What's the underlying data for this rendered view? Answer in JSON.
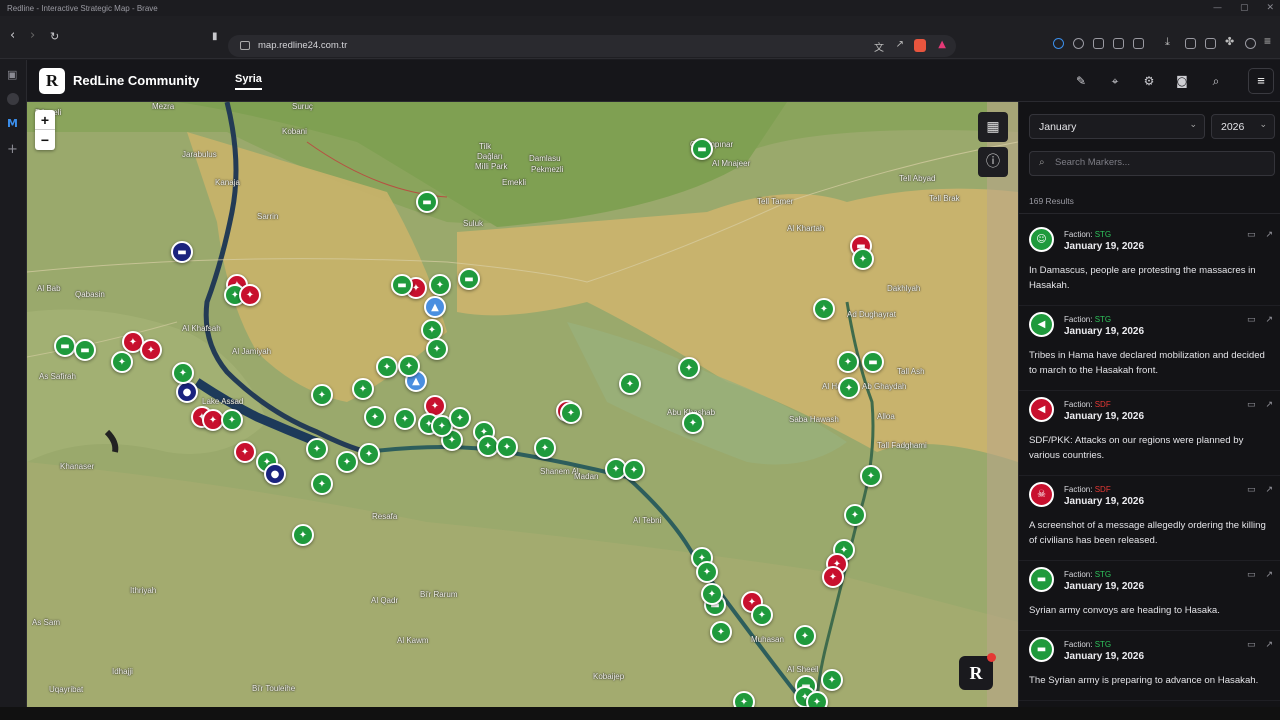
{
  "browser": {
    "title": "Redline - Interactive Strategic Map - Brave",
    "url": "map.redline24.com.tr",
    "icons": [
      "back-icon",
      "forward-icon",
      "reload-icon",
      "bookmark-icon",
      "translate-icon",
      "share-icon",
      "brave-shield-icon",
      "rewards-icon",
      "extensions-icon",
      "download-icon",
      "sidebar-toggle-icon",
      "wallet-icon",
      "menu-icon"
    ]
  },
  "app": {
    "logo": "R",
    "brand": "RedLine Community",
    "tab": "Syria",
    "header_icons": [
      "pen-icon",
      "pin-icon",
      "gear-icon",
      "camera-icon",
      "search-icon"
    ],
    "menu_icon": "hamburger-icon"
  },
  "map": {
    "zoom_in": "+",
    "zoom_out": "−",
    "controls": [
      "map-icon",
      "info-icon"
    ],
    "badge": "R",
    "labels": [
      {
        "text": "Mezra"
      },
      {
        "text": "Suruç"
      },
      {
        "text": "Düzceli"
      },
      {
        "text": "Kobani"
      },
      {
        "text": "Tilk"
      },
      {
        "text": "Dağları"
      },
      {
        "text": "Milli Park"
      },
      {
        "text": "Damlasu"
      },
      {
        "text": "Pekmezli"
      },
      {
        "text": "Emekli"
      },
      {
        "text": "Ceylanpınar"
      },
      {
        "text": "Al Mnajeer"
      },
      {
        "text": "Tell Abyad"
      },
      {
        "text": "Tell Brak"
      },
      {
        "text": "Tell Tamer"
      },
      {
        "text": "Al Khartah"
      },
      {
        "text": "Dakhlyah"
      },
      {
        "text": "Ad Dughayrat"
      },
      {
        "text": "Jarabulus"
      },
      {
        "text": "Kanaja"
      },
      {
        "text": "Sarrin"
      },
      {
        "text": "Suluk"
      },
      {
        "text": "Al Bab"
      },
      {
        "text": "Qabasin"
      },
      {
        "text": "Al Khafsah"
      },
      {
        "text": "Al Jamiyah"
      },
      {
        "text": "As Safirah"
      },
      {
        "text": "Lake Assad"
      },
      {
        "text": "Khanaser"
      },
      {
        "text": "Resafa"
      },
      {
        "text": "Shanem Al"
      },
      {
        "text": "Madan"
      },
      {
        "text": "Al Tebni"
      },
      {
        "text": "Al Qadr"
      },
      {
        "text": "Bi'r Rarum"
      },
      {
        "text": "Ithriyah"
      },
      {
        "text": "As Sam"
      },
      {
        "text": "Al Kawm"
      },
      {
        "text": "Kobaijep"
      },
      {
        "text": "Muhasan"
      },
      {
        "text": "Al Sheeil"
      },
      {
        "text": "Uqayribat"
      },
      {
        "text": "Bi'r Touleihe"
      },
      {
        "text": "Al Hawl"
      },
      {
        "text": "Tall Fadghami"
      },
      {
        "text": "Ab Ghaydah"
      },
      {
        "text": "Alloa"
      },
      {
        "text": "Tall Ash"
      },
      {
        "text": "Abu Khashab"
      },
      {
        "text": "Saba Hawash"
      },
      {
        "text": "Idhajji"
      }
    ],
    "markers": [
      {
        "c": "g",
        "i": "convoy"
      },
      {
        "c": "g",
        "i": "convoy"
      },
      {
        "c": "b",
        "i": "convoy"
      },
      {
        "c": "r",
        "i": "gun"
      },
      {
        "c": "g",
        "i": "gun"
      },
      {
        "c": "r",
        "i": "gun"
      },
      {
        "c": "g",
        "i": "convoy"
      },
      {
        "c": "g",
        "i": "convoy"
      },
      {
        "c": "r",
        "i": "gun"
      },
      {
        "c": "r",
        "i": "gun"
      },
      {
        "c": "g",
        "i": "gun"
      },
      {
        "c": "b",
        "i": "pin"
      },
      {
        "c": "r",
        "i": "gun"
      },
      {
        "c": "r",
        "i": "gun"
      },
      {
        "c": "r",
        "i": "gun"
      },
      {
        "c": "g",
        "i": "gun"
      },
      {
        "c": "b",
        "i": "pin"
      },
      {
        "c": "g",
        "i": "gun"
      },
      {
        "c": "g",
        "i": "gun"
      },
      {
        "c": "g",
        "i": "gun"
      },
      {
        "c": "g",
        "i": "convoy"
      },
      {
        "c": "r",
        "i": "gun"
      },
      {
        "c": "g",
        "i": "gun"
      },
      {
        "c": "g",
        "i": "convoy"
      },
      {
        "c": "lb",
        "i": "alert"
      },
      {
        "c": "g",
        "i": "gun"
      },
      {
        "c": "g",
        "i": "gun"
      },
      {
        "c": "g",
        "i": "gun"
      },
      {
        "c": "lb",
        "i": "alert"
      },
      {
        "c": "g",
        "i": "gun"
      },
      {
        "c": "g",
        "i": "gun"
      },
      {
        "c": "r",
        "i": "gun"
      },
      {
        "c": "g",
        "i": "gun"
      },
      {
        "c": "g",
        "i": "gun"
      },
      {
        "c": "g",
        "i": "gun"
      },
      {
        "c": "g",
        "i": "gun"
      },
      {
        "c": "g",
        "i": "gun"
      },
      {
        "c": "g",
        "i": "gun"
      },
      {
        "c": "g",
        "i": "gun"
      },
      {
        "c": "g",
        "i": "gun"
      },
      {
        "c": "g",
        "i": "gun"
      },
      {
        "c": "g",
        "i": "gun"
      },
      {
        "c": "g",
        "i": "gun"
      },
      {
        "c": "g",
        "i": "gun"
      },
      {
        "c": "g",
        "i": "gun"
      },
      {
        "c": "r",
        "i": "gun"
      },
      {
        "c": "g",
        "i": "gun"
      },
      {
        "c": "g",
        "i": "gun"
      },
      {
        "c": "g",
        "i": "gun"
      },
      {
        "c": "g",
        "i": "gun"
      },
      {
        "c": "g",
        "i": "gun"
      },
      {
        "c": "g",
        "i": "gun"
      },
      {
        "c": "g",
        "i": "gun"
      },
      {
        "c": "g",
        "i": "gun"
      },
      {
        "c": "g",
        "i": "convoy"
      },
      {
        "c": "g",
        "i": "gun"
      },
      {
        "c": "g",
        "i": "gun"
      },
      {
        "c": "g",
        "i": "gun"
      },
      {
        "c": "g",
        "i": "gun"
      },
      {
        "c": "r",
        "i": "gun"
      },
      {
        "c": "r",
        "i": "gun"
      },
      {
        "c": "g",
        "i": "gun"
      },
      {
        "c": "g",
        "i": "gun"
      },
      {
        "c": "g",
        "i": "gun"
      },
      {
        "c": "r",
        "i": "gun"
      },
      {
        "c": "g",
        "i": "gun"
      },
      {
        "c": "g",
        "i": "convoy"
      },
      {
        "c": "g",
        "i": "gun"
      },
      {
        "c": "g",
        "i": "gun"
      },
      {
        "c": "g",
        "i": "gun"
      },
      {
        "c": "g",
        "i": "gun"
      },
      {
        "c": "g",
        "i": "convoy"
      },
      {
        "c": "g",
        "i": "gun"
      },
      {
        "c": "g",
        "i": "gun"
      },
      {
        "c": "g",
        "i": "gun"
      },
      {
        "c": "r",
        "i": "convoy"
      },
      {
        "c": "g",
        "i": "gun"
      },
      {
        "c": "g",
        "i": "gun"
      }
    ]
  },
  "panel": {
    "month": "January",
    "year": "2026",
    "search_placeholder": "Search Markers...",
    "results": "169 Results",
    "items": [
      {
        "faction_label": "Faction:",
        "faction": "STG",
        "faction_color": "#2ec05a",
        "avatar": "g",
        "icon": "people-icon",
        "date": "January 19, 2026",
        "text": "In Damascus, people are protesting the massacres in Hasakah."
      },
      {
        "faction_label": "Faction:",
        "faction": "STG",
        "faction_color": "#2ec05a",
        "avatar": "g",
        "icon": "megaphone-icon",
        "date": "January 19, 2026",
        "text": "Tribes in Hama have declared mobilization and decided to march to the Hasakah front."
      },
      {
        "faction_label": "Faction:",
        "faction": "SDF",
        "faction_color": "#e53935",
        "avatar": "r",
        "icon": "megaphone-icon",
        "date": "January 19, 2026",
        "text": "SDF/PKK: Attacks on our regions were planned by various countries."
      },
      {
        "faction_label": "Faction:",
        "faction": "SDF",
        "faction_color": "#e53935",
        "avatar": "r",
        "icon": "skull-icon",
        "date": "January 19, 2026",
        "text": "A screenshot of a message allegedly ordering the killing of civilians has been released."
      },
      {
        "faction_label": "Faction:",
        "faction": "STG",
        "faction_color": "#2ec05a",
        "avatar": "g",
        "icon": "truck-icon",
        "date": "January 19, 2026",
        "text": "Syrian army convoys are heading to Hasaka."
      },
      {
        "faction_label": "Faction:",
        "faction": "STG",
        "faction_color": "#2ec05a",
        "avatar": "g",
        "icon": "truck-icon",
        "date": "January 19, 2026",
        "text": "The Syrian army is preparing to advance on Hasakah."
      }
    ]
  }
}
